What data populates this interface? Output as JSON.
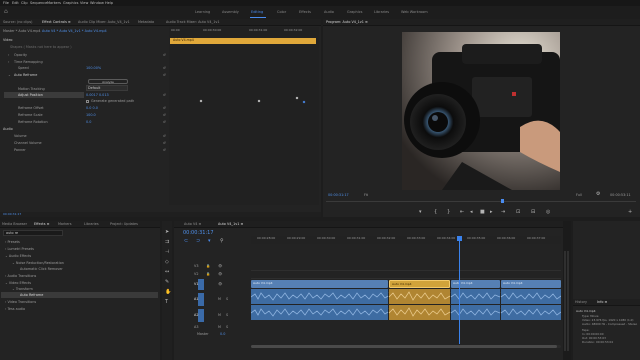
{
  "menubar": {
    "items": [
      "File",
      "Edit",
      "Clip",
      "Sequence",
      "Markers",
      "Graphics",
      "View",
      "Window",
      "Help"
    ]
  },
  "workspaces": {
    "items": [
      "Learning",
      "Assembly",
      "Editing",
      "Color",
      "Effects",
      "Audio",
      "Graphics",
      "Libraries",
      "Web Workroom"
    ],
    "active": "Editing"
  },
  "source_panel": {
    "tabs": [
      "Source: (no clips)",
      "Effect Controls ≡",
      "Audio Clip Mixer: Auto_V4_1v1",
      "Metadata",
      "Audio Track Mixer: Auto V4_1v1"
    ],
    "header_source": "Master * Auto V4.mp4",
    "header_clip": "Auto V4 * Auto V4_1v1 * Auto V4.mp4",
    "section_video": "Video",
    "hint": "Shapes ( Masks not here to appear )",
    "rows": [
      {
        "label": "Opacity"
      },
      {
        "label": "Time Remapping"
      },
      {
        "label": "Speed",
        "value": "100.00%"
      },
      {
        "label": "Auto Reframe"
      },
      {
        "label": "Analyze"
      },
      {
        "label": "Motion Tracking",
        "value": "Default"
      },
      {
        "label": "Adjust Position",
        "value": "0.0017   0.013"
      },
      {
        "label": "Generate generated path",
        "value": ""
      },
      {
        "label": "Reframe Offset",
        "value": "0.0   0.0"
      },
      {
        "label": "Reframe Scale",
        "value": "100.0"
      },
      {
        "label": "Reframe Rotation",
        "value": "0.0"
      }
    ],
    "section_audio": "Audio",
    "audio_rows": [
      "Volume",
      "Channel Volume",
      "Panner"
    ],
    "timecode": "00:00:31:17",
    "mini_clip_label": "Auto V4.mp4",
    "mini_times": [
      "00:00",
      "00:00:30:00",
      "00:00:31:00",
      "00:00:32:00"
    ]
  },
  "program": {
    "title": "Program: Auto V4_1v1 ≡",
    "timecode": "00:00:31:17",
    "fit": "Fit",
    "quality": "Full",
    "duration": "00:00:53:11"
  },
  "project": {
    "tabs": [
      "Media Browser",
      "Effects ≡",
      "Markers",
      "Libraries",
      "Project: Updates"
    ],
    "search": "auto re",
    "tree": [
      {
        "label": "Presets",
        "level": 0
      },
      {
        "label": "Lumetri Presets",
        "level": 0
      },
      {
        "label": "Audio Effects",
        "level": 0
      },
      {
        "label": "Noise Reduction/Restoration",
        "level": 1
      },
      {
        "label": "Automatic Click Remover",
        "level": 2
      },
      {
        "label": "Audio Transitions",
        "level": 0
      },
      {
        "label": "Video Effects",
        "level": 0
      },
      {
        "label": "Transform",
        "level": 1
      },
      {
        "label": "Auto Reframe",
        "level": 2
      },
      {
        "label": "Video Transitions",
        "level": 0
      },
      {
        "label": "Tess audio",
        "level": 0
      }
    ]
  },
  "timeline": {
    "tabs": [
      "Auto V4 ≡",
      "Auto V4_1v1 ≡"
    ],
    "timecode": "00:00:31:17",
    "ruler": [
      "00:00:28:00",
      "00:00:29:00",
      "00:00:30:00",
      "00:00:31:00",
      "00:00:32:00",
      "00:00:33:00",
      "00:00:34:00",
      "00:00:35:00",
      "00:00:36:00",
      "00:00:37:00"
    ],
    "tracks_video": [
      "V3",
      "V2",
      "V1"
    ],
    "tracks_audio": [
      "A1",
      "A2",
      "A3"
    ],
    "master": "Master",
    "master_value": "0.0",
    "clips_video": [
      "Auto V4.mp4",
      "Auto V4.mp4",
      "Auto V4.mp4",
      "Auto V4.mp4"
    ]
  },
  "info_panel": {
    "tabs": [
      "History",
      "Info ≡"
    ],
    "lines": [
      "Auto V4.mp4",
      "Type: Movie",
      "Video: 23.976 fps, 1920 x 1080 (1.0)",
      "Audio: 48000 Hz - Compressed - Stereo",
      "Tape:",
      "In: 00:00:00:00",
      "Out: 00:00:53:03",
      "Duration: 00:00:53:04"
    ]
  },
  "colors": {
    "accent": "#4a8cf0",
    "clip_video": "#5680b4",
    "clip_audio": "#3e6ca2",
    "selected": "#d1a33a",
    "playhead": "#3a82ec"
  }
}
